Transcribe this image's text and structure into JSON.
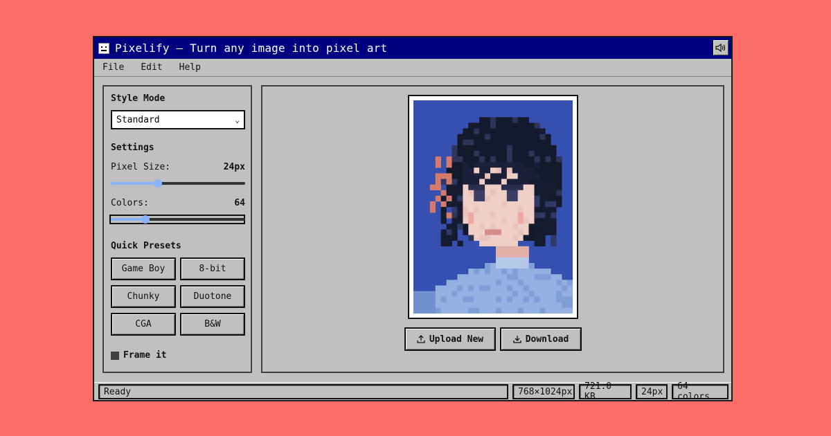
{
  "window": {
    "title": "Pixelify — Turn any image into pixel art",
    "app_icon": "robot-icon",
    "sound_icon": "speaker-icon"
  },
  "menu": [
    "File",
    "Edit",
    "Help"
  ],
  "sidebar": {
    "style_mode_title": "Style Mode",
    "style_mode_value": "Standard",
    "settings_title": "Settings",
    "pixel_size": {
      "label": "Pixel Size:",
      "value": "24px",
      "fraction": 0.35
    },
    "colors": {
      "label": "Colors:",
      "value": "64",
      "fraction": 0.26
    },
    "presets_title": "Quick Presets",
    "presets": [
      "Game Boy",
      "8-bit",
      "Chunky",
      "Duotone",
      "CGA",
      "B&W"
    ],
    "frame_label": "Frame it",
    "frame_checked": true
  },
  "main": {
    "upload_label": "Upload New",
    "upload_icon": "upload-icon",
    "download_label": "Download",
    "download_icon": "download-icon"
  },
  "status": {
    "text": "Ready",
    "dimensions": "768×1024px",
    "size": "721.0 KB",
    "pixel": "24px",
    "colors": "64 colors"
  },
  "colors": {
    "background": "#fd6e68",
    "titlebar": "#000080",
    "panel": "#c0c0c0",
    "slider_accent": "#8ab4f8",
    "image_bg": "#3550b0"
  }
}
